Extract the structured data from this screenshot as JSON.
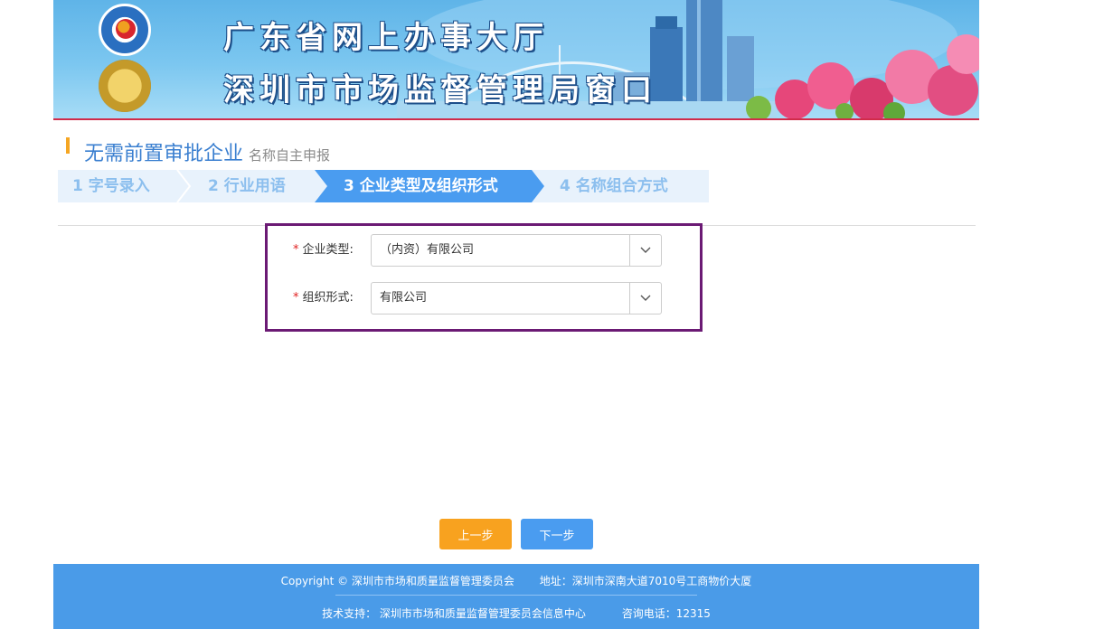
{
  "banner": {
    "line1": "广东省网上办事大厅",
    "line2": "深圳市市场监督管理局窗口"
  },
  "section": {
    "title": "无需前置审批企业",
    "subtitle": "名称自主申报"
  },
  "steps": [
    {
      "label": "1 字号录入",
      "active": false
    },
    {
      "label": "2 行业用语",
      "active": false
    },
    {
      "label": "3 企业类型及组织形式",
      "active": true
    },
    {
      "label": "4 名称组合方式",
      "active": false
    }
  ],
  "form": {
    "required_mark": "*",
    "enterprise_type": {
      "label": "企业类型:",
      "value": "（内资）有限公司"
    },
    "organization_form": {
      "label": "组织形式:",
      "value": "有限公司"
    },
    "arrow_icon": "chevron-down-icon"
  },
  "buttons": {
    "prev": "上一步",
    "next": "下一步"
  },
  "footer": {
    "copyright": "Copyright © 深圳市市场和质量监督管理委员会",
    "address": "地址：深圳市深南大道7010号工商物价大厦",
    "support": "技术支持： 深圳市市场和质量监督管理委员会信息中心",
    "phone": "咨询电话：12315"
  },
  "colors": {
    "accent": "#4a9cf0",
    "prev_button": "#f8a21f",
    "title": "#3a7fd0",
    "highlight_border": "#6b1a74",
    "footer": "#4a9be8"
  }
}
